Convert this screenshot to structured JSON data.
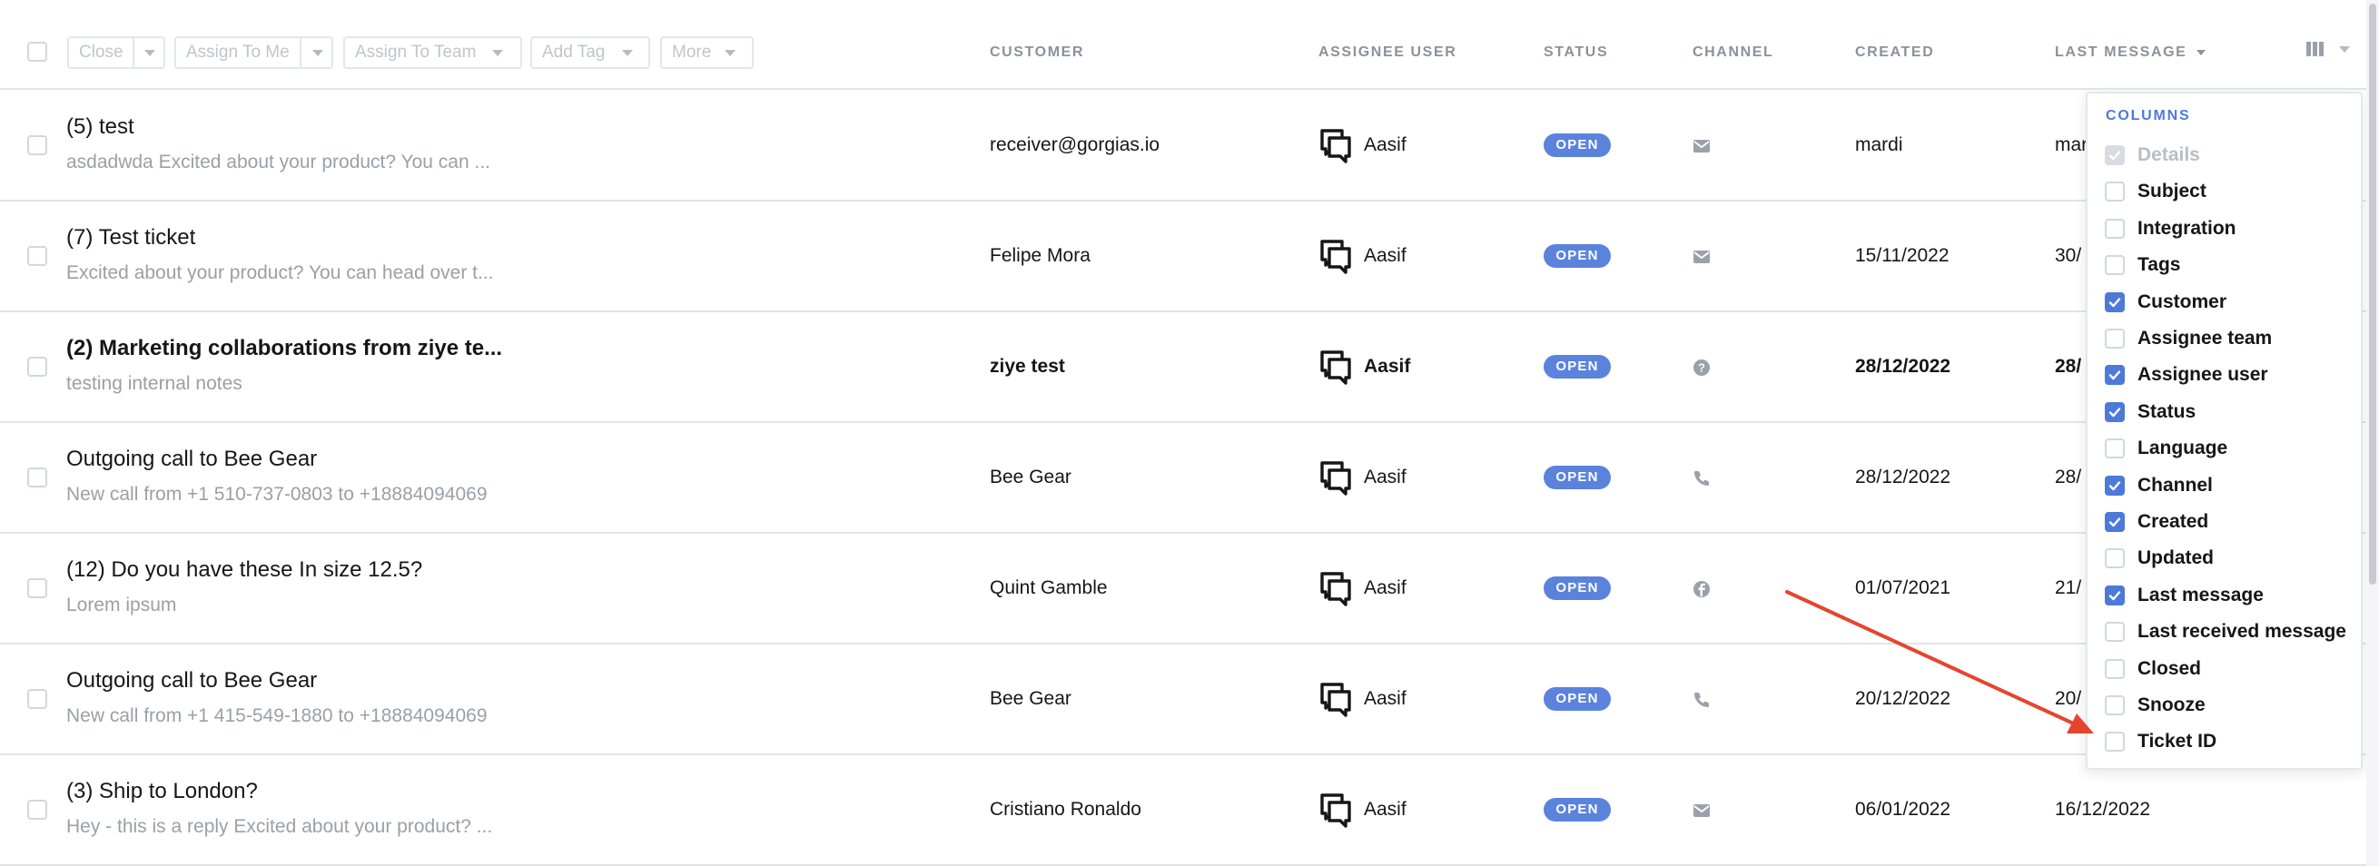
{
  "toolbar": {
    "close_label": "Close",
    "assign_me_label": "Assign To Me",
    "assign_team_label": "Assign To Team",
    "add_tag_label": "Add Tag",
    "more_label": "More"
  },
  "columns": {
    "customer": "CUSTOMER",
    "assignee_user": "ASSIGNEE USER",
    "status": "STATUS",
    "channel": "CHANNEL",
    "created": "CREATED",
    "last_message": "LAST MESSAGE"
  },
  "tickets": [
    {
      "subject": "(5) test",
      "excerpt": "asdadwda Excited about your product? You can ...",
      "customer": "receiver@gorgias.io",
      "assignee": "Aasif",
      "status": "OPEN",
      "channel": "email-icon",
      "created": "mardi",
      "last_message": "mar"
    },
    {
      "subject": "(7) Test ticket",
      "excerpt": "Excited about your product? You can head over t...",
      "customer": "Felipe Mora",
      "assignee": "Aasif",
      "status": "OPEN",
      "channel": "email-icon",
      "created": "15/11/2022",
      "last_message": "30/"
    },
    {
      "subject": "(2) Marketing collaborations from ziye te...",
      "excerpt": "testing internal notes",
      "customer": "ziye test",
      "assignee": "Aasif",
      "status": "OPEN",
      "channel": "help-icon",
      "created": "28/12/2022",
      "last_message": "28/",
      "unread": true
    },
    {
      "subject": "Outgoing call to Bee Gear",
      "excerpt": "New call from +1 510-737-0803 to +18884094069",
      "customer": "Bee Gear",
      "assignee": "Aasif",
      "status": "OPEN",
      "channel": "phone-icon",
      "created": "28/12/2022",
      "last_message": "28/"
    },
    {
      "subject": "(12) Do you have these In size 12.5?",
      "excerpt": "Lorem ipsum",
      "customer": "Quint Gamble",
      "assignee": "Aasif",
      "status": "OPEN",
      "channel": "facebook-icon",
      "created": "01/07/2021",
      "last_message": "21/"
    },
    {
      "subject": "Outgoing call to Bee Gear",
      "excerpt": "New call from +1 415-549-1880 to +18884094069",
      "customer": "Bee Gear",
      "assignee": "Aasif",
      "status": "OPEN",
      "channel": "phone-icon",
      "created": "20/12/2022",
      "last_message": "20/"
    },
    {
      "subject": "(3) Ship to London?",
      "excerpt": "Hey - this is a reply Excited about your product? ...",
      "customer": "Cristiano Ronaldo",
      "assignee": "Aasif",
      "status": "OPEN",
      "channel": "email-icon",
      "created": "06/01/2022",
      "last_message": "16/12/2022"
    }
  ],
  "column_menu": {
    "title": "COLUMNS",
    "items": [
      {
        "label": "Details",
        "checked": true,
        "disabled": true
      },
      {
        "label": "Subject",
        "checked": false
      },
      {
        "label": "Integration",
        "checked": false
      },
      {
        "label": "Tags",
        "checked": false
      },
      {
        "label": "Customer",
        "checked": true
      },
      {
        "label": "Assignee team",
        "checked": false
      },
      {
        "label": "Assignee user",
        "checked": true
      },
      {
        "label": "Status",
        "checked": true
      },
      {
        "label": "Language",
        "checked": false
      },
      {
        "label": "Channel",
        "checked": true
      },
      {
        "label": "Created",
        "checked": true
      },
      {
        "label": "Updated",
        "checked": false
      },
      {
        "label": "Last message",
        "checked": true
      },
      {
        "label": "Last received message",
        "checked": false
      },
      {
        "label": "Closed",
        "checked": false
      },
      {
        "label": "Snooze",
        "checked": false
      },
      {
        "label": "Ticket ID",
        "checked": false
      }
    ]
  },
  "colors": {
    "accent": "#4d7ad8",
    "status_open": "#5b83dd",
    "annotation_arrow": "#e5452f"
  }
}
